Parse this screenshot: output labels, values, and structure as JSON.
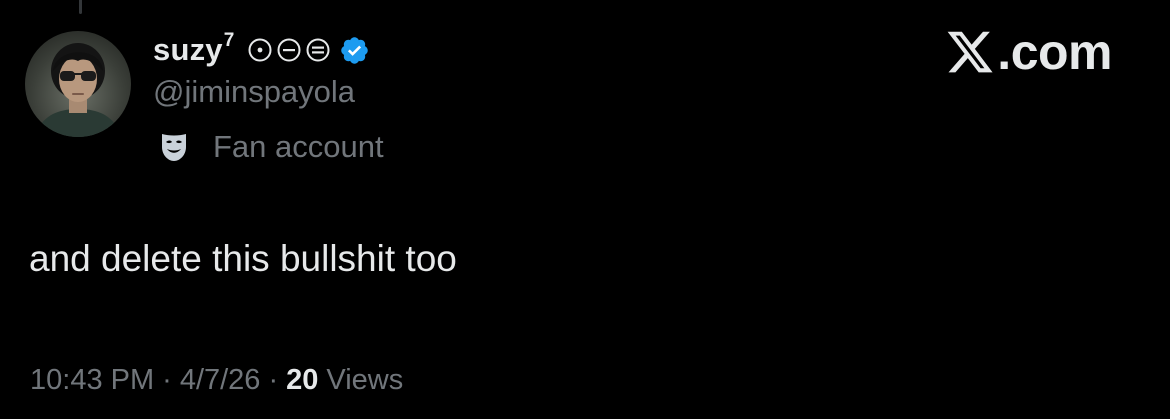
{
  "post": {
    "author": {
      "display_name": "suzy",
      "display_name_suffix": "7",
      "name_emojis": [
        "circle-dot",
        "circle-minus",
        "circle-equals"
      ],
      "verified_icon": "verified-badge-icon",
      "handle": "@jiminspayola",
      "avatar_icon": "avatar-photo",
      "account_label": {
        "icon": "theater-mask-icon",
        "text": "Fan account"
      }
    },
    "brand": {
      "logo_icon": "x-logo-icon",
      "text": ".com"
    },
    "text": "and delete this bullshit too",
    "meta": {
      "time": "10:43 PM",
      "separator": "·",
      "date": "4/7/26",
      "views_count": "20",
      "views_label": "Views"
    }
  },
  "colors": {
    "background": "#000000",
    "primary_text": "#e7e9ea",
    "secondary_text": "#71767b",
    "verified_blue": "#1d9bf0"
  }
}
